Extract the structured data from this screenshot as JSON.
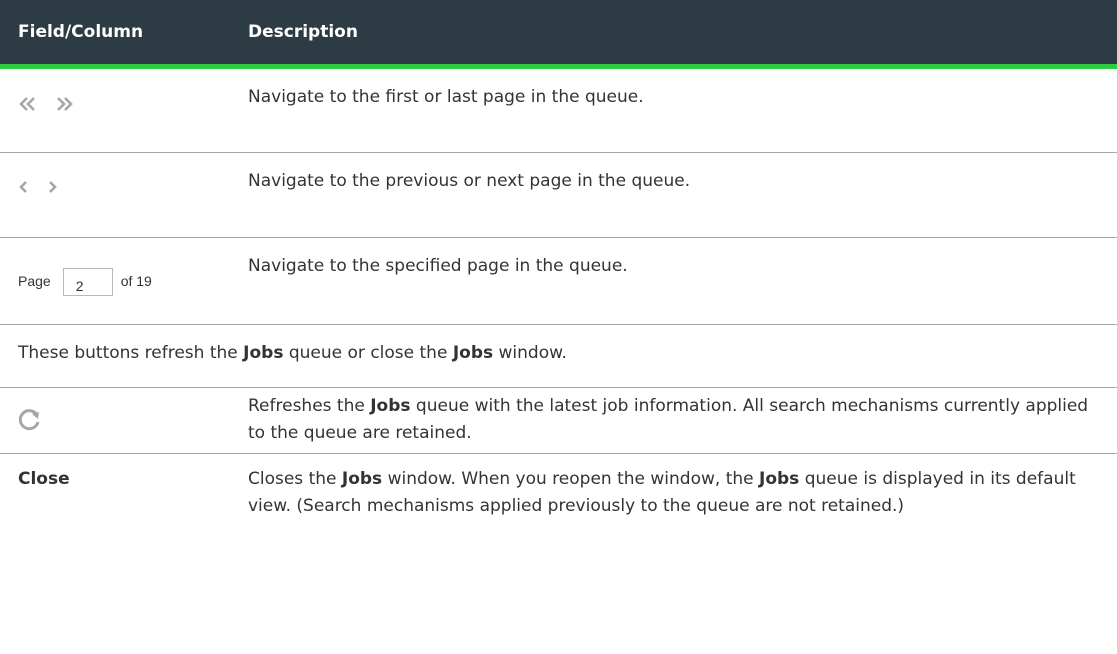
{
  "header": {
    "col1": "Field/Column",
    "col2": "Description"
  },
  "rows": {
    "first_last": {
      "icon1": "double-chevron-left-icon",
      "icon2": "double-chevron-right-icon",
      "desc": "Navigate to the first or last page in the queue."
    },
    "prev_next": {
      "icon1": "chevron-left-icon",
      "icon2": "chevron-right-icon",
      "desc": "Navigate to the previous or next page in the queue."
    },
    "page": {
      "label": "Page",
      "value": "2",
      "of": "of 19",
      "desc": "Navigate to the specified page in the queue."
    },
    "section_note": {
      "part1": "These buttons refresh the ",
      "b1": "Jobs",
      "part2": " queue or close the ",
      "b2": "Jobs",
      "part3": " window."
    },
    "refresh": {
      "icon": "refresh-icon",
      "part1": "Refreshes the ",
      "b1": "Jobs",
      "part2": " queue with the latest job information. All search mechanisms currently applied to the queue are retained."
    },
    "close": {
      "label": "Close",
      "part1": "Closes the ",
      "b1": "Jobs",
      "part2": " window. When you reopen the window, the ",
      "b2": "Jobs",
      "part3": " queue is displayed in its default view. (Search mechanisms applied previously to the queue are not retained.)"
    }
  },
  "colors": {
    "header_bg": "#2d3b45",
    "header_accent": "#2ecc40",
    "icon_gray": "#a6a6a6"
  }
}
